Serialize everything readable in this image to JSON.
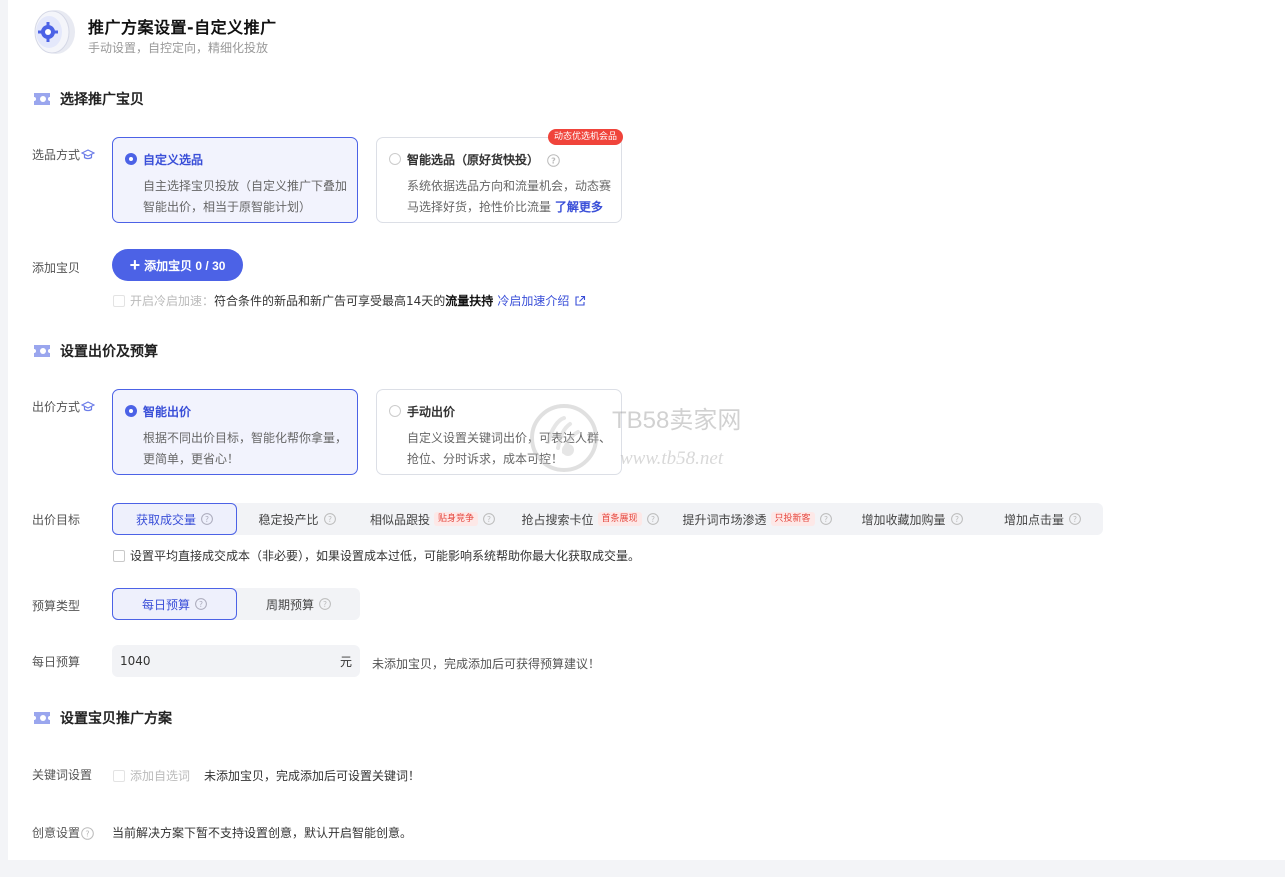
{
  "header": {
    "title": "推广方案设置-自定义推广",
    "subtitle": "手动设置，自控定向，精细化投放"
  },
  "section_product": {
    "title": "选择推广宝贝",
    "select_label": "选品方式",
    "options": [
      {
        "title": "自定义选品",
        "desc": "自主选择宝贝投放（自定义推广下叠加智能出价，相当于原智能计划）",
        "selected": true
      },
      {
        "title": "智能选品（原好货快投）",
        "desc": "系统依据选品方向和流量机会，动态赛马选择好货，抢性价比流量",
        "link": "了解更多",
        "tag": "动态优选机会品",
        "selected": false
      }
    ],
    "add_label": "添加宝贝",
    "add_button": "添加宝贝 0 / 30",
    "cold_start": {
      "label": "开启冷启加速：",
      "text": "符合条件的新品和新广告可享受最高14天的",
      "bold": "流量扶持",
      "link": "冷启加速介绍"
    }
  },
  "section_bid": {
    "title": "设置出价及预算",
    "bid_label": "出价方式",
    "options": [
      {
        "title": "智能出价",
        "desc": "根据不同出价目标，智能化帮你拿量，更简单，更省心！",
        "selected": true
      },
      {
        "title": "手动出价",
        "desc": "自定义设置关键词出价，可表达人群、抢位、分时诉求，成本可控！",
        "selected": false
      }
    ],
    "goal_label": "出价目标",
    "goals": [
      {
        "label": "获取成交量",
        "active": true,
        "tag": ""
      },
      {
        "label": "稳定投产比",
        "active": false,
        "tag": ""
      },
      {
        "label": "相似品跟投",
        "active": false,
        "tag": "贴身竞争"
      },
      {
        "label": "抢占搜索卡位",
        "active": false,
        "tag": "首条展现"
      },
      {
        "label": "提升词市场渗透",
        "active": false,
        "tag": "只投新客"
      },
      {
        "label": "增加收藏加购量",
        "active": false,
        "tag": ""
      },
      {
        "label": "增加点击量",
        "active": false,
        "tag": ""
      }
    ],
    "avg_cost_text": "设置平均直接成交成本（非必要），如果设置成本过低，可能影响系统帮助你最大化获取成交量。",
    "budget_type_label": "预算类型",
    "budget_types": [
      {
        "label": "每日预算",
        "active": true
      },
      {
        "label": "周期预算",
        "active": false
      }
    ],
    "daily_label": "每日预算",
    "daily_value": "1040",
    "daily_unit": "元",
    "daily_hint": "未添加宝贝，完成添加后可获得预算建议！"
  },
  "section_plan": {
    "title": "设置宝贝推广方案",
    "keyword_label": "关键词设置",
    "keyword_check": "添加自选词",
    "keyword_hint": "未添加宝贝，完成添加后可设置关键词！",
    "creative_label": "创意设置",
    "creative_hint": "当前解决方案下暂不支持设置创意，默认开启智能创意。"
  },
  "watermark": {
    "name": "TB58卖家网",
    "url": "www.tb58.net"
  },
  "colors": {
    "accent": "#4c62e6",
    "tag_red": "#f0443b"
  }
}
